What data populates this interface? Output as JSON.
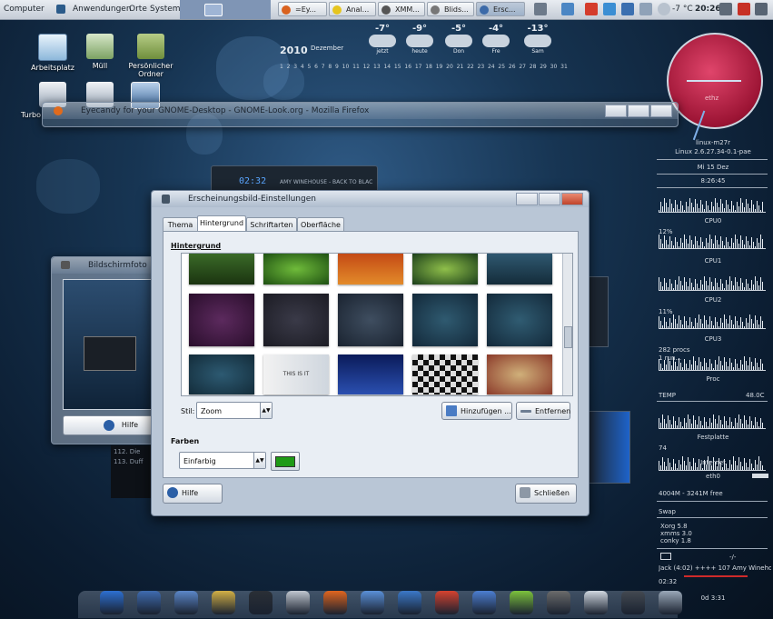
{
  "panel": {
    "menus": [
      "Computer",
      "Anwendungen",
      "Orte",
      "System"
    ],
    "tasks": [
      "=Ey...",
      "Anal...",
      "XMM...",
      "Blids...",
      "Ersc..."
    ],
    "temperature": "-7 °C",
    "clock": "20:26"
  },
  "desktop_icons": [
    "Arbeitsplatz",
    "Müll",
    "Persönlicher Ordner",
    "Turbo"
  ],
  "weather": {
    "year": "2010",
    "month": "Dezember",
    "days": [
      {
        "temp": "-7°",
        "label": "jetzt"
      },
      {
        "temp": "-9°",
        "label": "heute"
      },
      {
        "temp": "-5°",
        "label": "Don"
      },
      {
        "temp": "-4°",
        "label": "Fre"
      },
      {
        "temp": "-13°",
        "label": "Sam"
      }
    ],
    "calendar_days": "1  2  3  4  5  6  7  8  9  10  11  12  13  14  15  16  17  18  19  20  21  22  23  24  25  26  27  28  29  30  31"
  },
  "firefox_window": {
    "title": "Eyecandy for your GNOME-Desktop - GNOME-Look.org - Mozilla Firefox"
  },
  "music_player": {
    "time": "02:32",
    "track": "AMY WINEHOUSE - BACK TO BLAC"
  },
  "screenshot_window": {
    "title": "Bildschirmfoto",
    "help_label": "Hilfe",
    "list": [
      "112. Die",
      "113. Duff"
    ]
  },
  "dialog": {
    "title": "Erscheinungsbild-Einstellungen",
    "tabs": [
      "Thema",
      "Hintergrund",
      "Schriftarten",
      "Oberfläche"
    ],
    "section_background": "Hintergrund",
    "style_label": "Stil:",
    "style_value": "Zoom",
    "add_label": "Hinzufügen ...",
    "remove_label": "Entfernen",
    "section_colors": "Farben",
    "color_mode": "Einfarbig",
    "color_value": "#1f9a16",
    "help_label": "Hilfe",
    "close_label": "Schließen",
    "wallpaper_thumbnail_text": "THIS IS IT"
  },
  "conky": {
    "host": "linux-m27r",
    "kernel": "Linux 2.6.27.34-0.1-pae",
    "date": "Mi 15 Dez",
    "time": "8:26:45",
    "cpu_labels": [
      "CPU0",
      "CPU1",
      "CPU2",
      "CPU3"
    ],
    "cpu_values": [
      "12%",
      "11%"
    ],
    "proc_line1": "282 procs",
    "proc_line2": "1 run...",
    "proc_label": "Proc",
    "temp_label": "TEMP",
    "temp_value": "48.0C",
    "disk_label": "Festplatte",
    "disk_value": "74",
    "net_label": "Internet",
    "net_iface": "eth0",
    "mem_line": "4004M - 3241M free",
    "swap_label": "Swap",
    "load1": "Xorg  5.8",
    "load2": "xmms  3.0",
    "load3": "conky  1.8",
    "mail_count": "-/-",
    "track": "Jack (4:02) ++++ 107  Amy Winehous",
    "elapsed": "02:32",
    "uptime": "0d 3:31"
  },
  "clock_widget": {
    "label": "ethz"
  },
  "dock_icons": [
    "globe-icon",
    "home-icon",
    "mail-icon",
    "editor-icon",
    "terminal-icon",
    "system-monitor-icon",
    "firefox-icon",
    "music-icon",
    "network-icon",
    "paint-icon",
    "document-icon",
    "chat-icon",
    "gimp-icon",
    "disc-icon",
    "camera-icon",
    "trash-icon"
  ],
  "colors": {
    "accent": "#2b5b8a",
    "desktop": "#173553",
    "conky_text": "#d7dde4"
  }
}
